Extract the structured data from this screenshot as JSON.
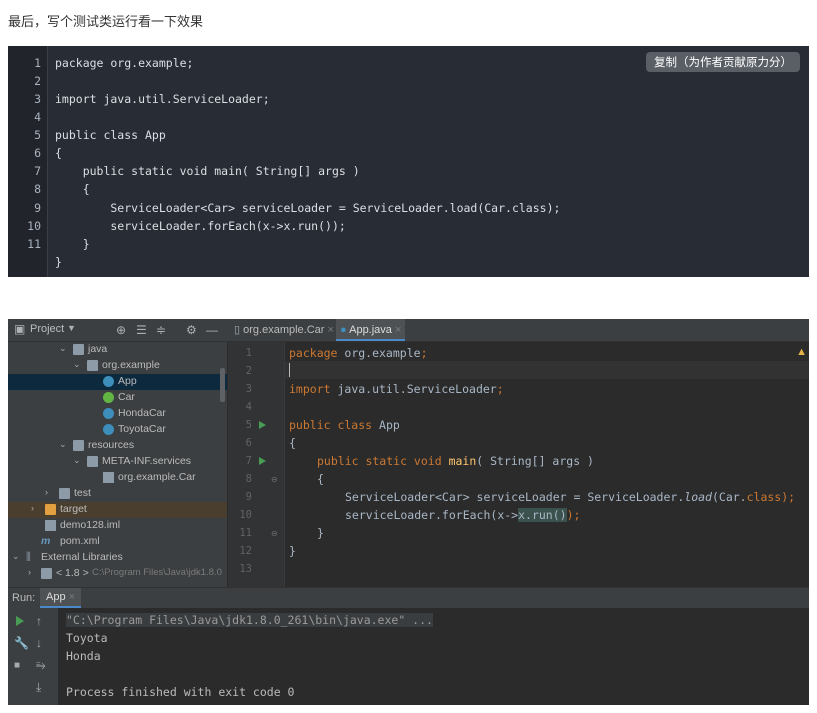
{
  "intro_text": "最后，写个测试类运行看一下效果",
  "code_block": {
    "copy_button": "复制（为作者贡献原力分）",
    "line_numbers": [
      "1",
      "2",
      "3",
      "4",
      "5",
      "6",
      "7",
      "8",
      "9",
      "10",
      "11"
    ],
    "lines": [
      "package org.example;",
      "",
      "import java.util.ServiceLoader;",
      "",
      "public class App",
      "{",
      "    public static void main( String[] args )",
      "    {",
      "        ServiceLoader<Car> serviceLoader = ServiceLoader.load(Car.class);",
      "        serviceLoader.forEach(x->x.run());",
      "    }",
      "}"
    ]
  },
  "ide": {
    "toolbar": {
      "project_label": "Project",
      "tab_car": "org.example.Car",
      "tab_app": "App.java",
      "tab_close": "×"
    },
    "tree": [
      {
        "label": "java"
      },
      {
        "label": "org.example"
      },
      {
        "label": "App"
      },
      {
        "label": "Car"
      },
      {
        "label": "HondaCar"
      },
      {
        "label": "ToyotaCar"
      },
      {
        "label": "resources"
      },
      {
        "label": "META-INF.services"
      },
      {
        "label": "org.example.Car"
      },
      {
        "label": "test"
      },
      {
        "label": "target"
      },
      {
        "label": "demo128.iml"
      },
      {
        "label": "pom.xml"
      },
      {
        "label": "External Libraries"
      },
      {
        "label": "< 1.8 >"
      },
      {
        "label": "C:\\Program Files\\Java\\jdk1.8.0"
      }
    ],
    "editor": {
      "line_numbers": [
        "1",
        "2",
        "3",
        "4",
        "5",
        "6",
        "7",
        "8",
        "9",
        "10",
        "11",
        "12",
        "13"
      ],
      "package_kw": "package",
      "package_name": " org.example",
      "semicolon": ";",
      "import_kw": "import",
      "import_name": " java.util.ServiceLoader",
      "class_kw": "public class",
      "class_name": " App",
      "open_brace": "{",
      "close_brace": "}",
      "main_kw": "public static void",
      "main_name": "main",
      "main_args": "( String[] args )",
      "line9_a": "ServiceLoader<Car> serviceLoader = ServiceLoader.",
      "line9_load": "load",
      "line9_b": "(Car.",
      "line9_class": "class",
      "line9_c": ");",
      "line10_a": "serviceLoader.forEach(x->",
      "line10_hl": "x.run()",
      "line10_b": ");"
    },
    "run": {
      "label": "Run:",
      "tab": "App",
      "output": [
        "\"C:\\Program Files\\Java\\jdk1.8.0_261\\bin\\java.exe\" ...",
        "Toyota",
        "Honda",
        "",
        "Process finished with exit code 0"
      ]
    }
  }
}
